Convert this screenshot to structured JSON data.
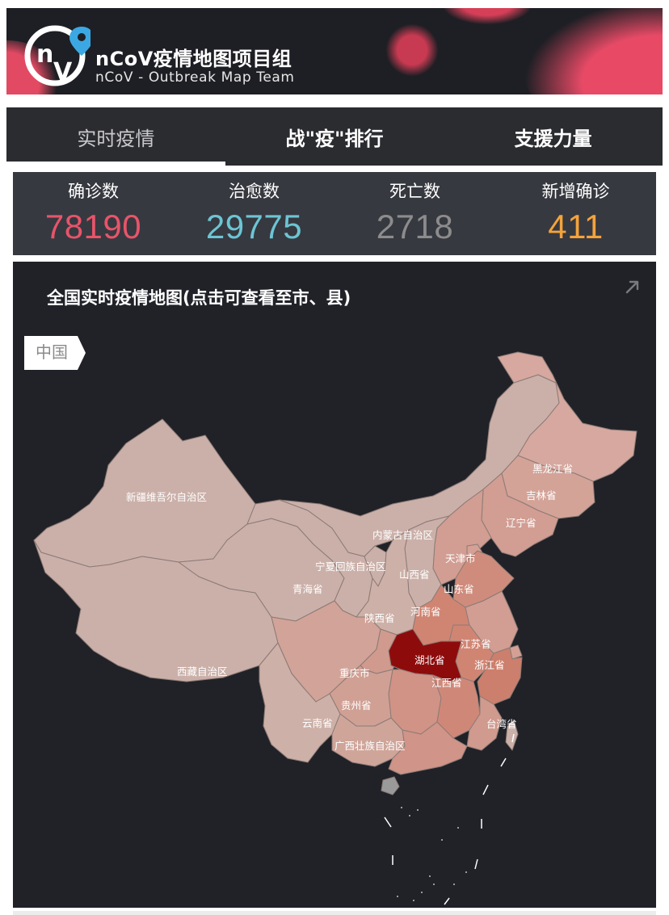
{
  "brand": {
    "title": "nCoV疫情地图项目组",
    "subtitle": "nCoV - Outbreak Map Team",
    "logo_text": "nV",
    "logo_pin_icon": "location-pin-icon"
  },
  "tabs": [
    {
      "label": "实时疫情",
      "active": true
    },
    {
      "label": "战\"疫\"排行",
      "active": false
    },
    {
      "label": "支援力量",
      "active": false
    }
  ],
  "stats": [
    {
      "label": "确诊数",
      "value": "78190",
      "color": "#e8546a"
    },
    {
      "label": "治愈数",
      "value": "29775",
      "color": "#6cc5d4"
    },
    {
      "label": "死亡数",
      "value": "2718",
      "color": "#8c8c8c"
    },
    {
      "label": "新增确诊",
      "value": "411",
      "color": "#f3a33c"
    }
  ],
  "map": {
    "title": "全国实时疫情地图(点击可查看至市、县)",
    "breadcrumb": "中国",
    "expand_icon": "expand-arrow-icon",
    "colors": {
      "background": "#212228",
      "province_low": "#cbb0a9",
      "province_light": "#d29d92",
      "province_mid": "#d08573",
      "hubei": "#8e0b0c",
      "hainan": "#9a9a9a",
      "border": "#8c7b76"
    },
    "labels": {
      "xinjiang": "新疆维吾尔自治区",
      "xizang": "西藏自治区",
      "qinghai": "青海省",
      "neimenggu": "内蒙古自治区",
      "ningxia": "宁夏回族自治区",
      "shanxi": "山西省",
      "shaanxi": "陕西省",
      "henan": "河南省",
      "hubei": "湖北省",
      "jiangsu": "江苏省",
      "zhejiang": "浙江省",
      "jiangxi": "江西省",
      "chongqing": "重庆市",
      "guizhou": "贵州省",
      "yunnan": "云南省",
      "guangxi": "广西壮族自治区",
      "taiwan": "台湾省",
      "heilongjiang": "黑龙江省",
      "jilin": "吉林省",
      "liaoning": "辽宁省",
      "tianjin": "天津市",
      "shandong": "山东省"
    }
  }
}
